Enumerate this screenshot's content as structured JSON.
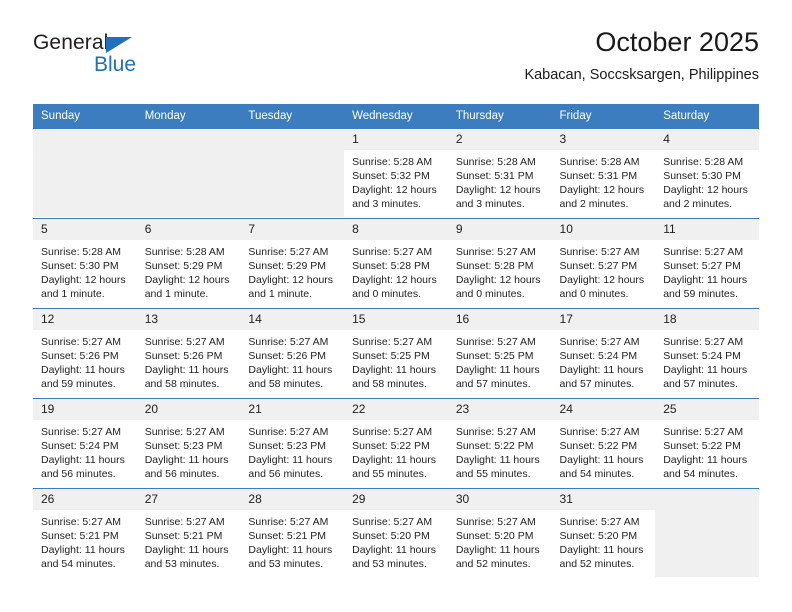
{
  "brand": {
    "name_dark": "General",
    "name_blue": "Blue",
    "accent_color": "#1f70bf"
  },
  "header": {
    "title": "October 2025",
    "location": "Kabacan, Soccsksargen, Philippines"
  },
  "theme": {
    "header_row_bg": "#3b7dbf",
    "daynum_bg": "#f0f0f0",
    "row_border": "#3b7dbf",
    "text": "#232323"
  },
  "weekdays": [
    "Sunday",
    "Monday",
    "Tuesday",
    "Wednesday",
    "Thursday",
    "Friday",
    "Saturday"
  ],
  "labels": {
    "sunrise": "Sunrise:",
    "sunset": "Sunset:",
    "daylight": "Daylight:"
  },
  "weeks": [
    [
      {
        "day": "",
        "empty": true
      },
      {
        "day": "",
        "empty": true
      },
      {
        "day": "",
        "empty": true
      },
      {
        "day": "1",
        "sunrise": "Sunrise: 5:28 AM",
        "sunset": "Sunset: 5:32 PM",
        "daylight": "Daylight: 12 hours and 3 minutes."
      },
      {
        "day": "2",
        "sunrise": "Sunrise: 5:28 AM",
        "sunset": "Sunset: 5:31 PM",
        "daylight": "Daylight: 12 hours and 3 minutes."
      },
      {
        "day": "3",
        "sunrise": "Sunrise: 5:28 AM",
        "sunset": "Sunset: 5:31 PM",
        "daylight": "Daylight: 12 hours and 2 minutes."
      },
      {
        "day": "4",
        "sunrise": "Sunrise: 5:28 AM",
        "sunset": "Sunset: 5:30 PM",
        "daylight": "Daylight: 12 hours and 2 minutes."
      }
    ],
    [
      {
        "day": "5",
        "sunrise": "Sunrise: 5:28 AM",
        "sunset": "Sunset: 5:30 PM",
        "daylight": "Daylight: 12 hours and 1 minute."
      },
      {
        "day": "6",
        "sunrise": "Sunrise: 5:28 AM",
        "sunset": "Sunset: 5:29 PM",
        "daylight": "Daylight: 12 hours and 1 minute."
      },
      {
        "day": "7",
        "sunrise": "Sunrise: 5:27 AM",
        "sunset": "Sunset: 5:29 PM",
        "daylight": "Daylight: 12 hours and 1 minute."
      },
      {
        "day": "8",
        "sunrise": "Sunrise: 5:27 AM",
        "sunset": "Sunset: 5:28 PM",
        "daylight": "Daylight: 12 hours and 0 minutes."
      },
      {
        "day": "9",
        "sunrise": "Sunrise: 5:27 AM",
        "sunset": "Sunset: 5:28 PM",
        "daylight": "Daylight: 12 hours and 0 minutes."
      },
      {
        "day": "10",
        "sunrise": "Sunrise: 5:27 AM",
        "sunset": "Sunset: 5:27 PM",
        "daylight": "Daylight: 12 hours and 0 minutes."
      },
      {
        "day": "11",
        "sunrise": "Sunrise: 5:27 AM",
        "sunset": "Sunset: 5:27 PM",
        "daylight": "Daylight: 11 hours and 59 minutes."
      }
    ],
    [
      {
        "day": "12",
        "sunrise": "Sunrise: 5:27 AM",
        "sunset": "Sunset: 5:26 PM",
        "daylight": "Daylight: 11 hours and 59 minutes."
      },
      {
        "day": "13",
        "sunrise": "Sunrise: 5:27 AM",
        "sunset": "Sunset: 5:26 PM",
        "daylight": "Daylight: 11 hours and 58 minutes."
      },
      {
        "day": "14",
        "sunrise": "Sunrise: 5:27 AM",
        "sunset": "Sunset: 5:26 PM",
        "daylight": "Daylight: 11 hours and 58 minutes."
      },
      {
        "day": "15",
        "sunrise": "Sunrise: 5:27 AM",
        "sunset": "Sunset: 5:25 PM",
        "daylight": "Daylight: 11 hours and 58 minutes."
      },
      {
        "day": "16",
        "sunrise": "Sunrise: 5:27 AM",
        "sunset": "Sunset: 5:25 PM",
        "daylight": "Daylight: 11 hours and 57 minutes."
      },
      {
        "day": "17",
        "sunrise": "Sunrise: 5:27 AM",
        "sunset": "Sunset: 5:24 PM",
        "daylight": "Daylight: 11 hours and 57 minutes."
      },
      {
        "day": "18",
        "sunrise": "Sunrise: 5:27 AM",
        "sunset": "Sunset: 5:24 PM",
        "daylight": "Daylight: 11 hours and 57 minutes."
      }
    ],
    [
      {
        "day": "19",
        "sunrise": "Sunrise: 5:27 AM",
        "sunset": "Sunset: 5:24 PM",
        "daylight": "Daylight: 11 hours and 56 minutes."
      },
      {
        "day": "20",
        "sunrise": "Sunrise: 5:27 AM",
        "sunset": "Sunset: 5:23 PM",
        "daylight": "Daylight: 11 hours and 56 minutes."
      },
      {
        "day": "21",
        "sunrise": "Sunrise: 5:27 AM",
        "sunset": "Sunset: 5:23 PM",
        "daylight": "Daylight: 11 hours and 56 minutes."
      },
      {
        "day": "22",
        "sunrise": "Sunrise: 5:27 AM",
        "sunset": "Sunset: 5:22 PM",
        "daylight": "Daylight: 11 hours and 55 minutes."
      },
      {
        "day": "23",
        "sunrise": "Sunrise: 5:27 AM",
        "sunset": "Sunset: 5:22 PM",
        "daylight": "Daylight: 11 hours and 55 minutes."
      },
      {
        "day": "24",
        "sunrise": "Sunrise: 5:27 AM",
        "sunset": "Sunset: 5:22 PM",
        "daylight": "Daylight: 11 hours and 54 minutes."
      },
      {
        "day": "25",
        "sunrise": "Sunrise: 5:27 AM",
        "sunset": "Sunset: 5:22 PM",
        "daylight": "Daylight: 11 hours and 54 minutes."
      }
    ],
    [
      {
        "day": "26",
        "sunrise": "Sunrise: 5:27 AM",
        "sunset": "Sunset: 5:21 PM",
        "daylight": "Daylight: 11 hours and 54 minutes."
      },
      {
        "day": "27",
        "sunrise": "Sunrise: 5:27 AM",
        "sunset": "Sunset: 5:21 PM",
        "daylight": "Daylight: 11 hours and 53 minutes."
      },
      {
        "day": "28",
        "sunrise": "Sunrise: 5:27 AM",
        "sunset": "Sunset: 5:21 PM",
        "daylight": "Daylight: 11 hours and 53 minutes."
      },
      {
        "day": "29",
        "sunrise": "Sunrise: 5:27 AM",
        "sunset": "Sunset: 5:20 PM",
        "daylight": "Daylight: 11 hours and 53 minutes."
      },
      {
        "day": "30",
        "sunrise": "Sunrise: 5:27 AM",
        "sunset": "Sunset: 5:20 PM",
        "daylight": "Daylight: 11 hours and 52 minutes."
      },
      {
        "day": "31",
        "sunrise": "Sunrise: 5:27 AM",
        "sunset": "Sunset: 5:20 PM",
        "daylight": "Daylight: 11 hours and 52 minutes."
      },
      {
        "day": "",
        "empty": true
      }
    ]
  ]
}
